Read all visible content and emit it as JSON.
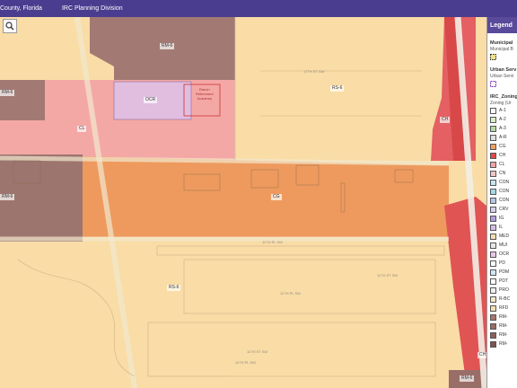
{
  "header": {
    "county": "County, Florida",
    "division": "IRC Planning Division"
  },
  "map": {
    "zones": {
      "rm6_top": "RM-6",
      "rm6_left": "RM-6",
      "rm6_mid": "RM-6",
      "rm6_bottom": "RM-6",
      "ocr": "OCR",
      "cl": "CL",
      "rs6_top": "RS-6",
      "ch": "CH",
      "cg": "CG",
      "rs6_bottom": "RS-6",
      "ch_bottom": "CH"
    },
    "building_label": "Ranch\nRetirement\nAcademy",
    "streets": [
      "17TH ST SW",
      "11TH PL SW",
      "11TH ST SW",
      "11TH PL SW",
      "11TH ST SW",
      "11TH PL SW"
    ]
  },
  "search": {
    "icon": "search-icon"
  },
  "legend": {
    "title": "Legend",
    "layers": [
      {
        "name": "Municipal",
        "sub": "Municipal B"
      },
      {
        "name": "Urban Serv",
        "sub": "Urban Servi"
      },
      {
        "name": "IRC_Zoning",
        "sub": "Zoning (Ur"
      }
    ],
    "items": [
      {
        "code": "A-1",
        "color": "#ffffff"
      },
      {
        "code": "A-2",
        "color": "#dcedc8"
      },
      {
        "code": "A-3",
        "color": "#b6d7a8"
      },
      {
        "code": "A-R",
        "color": "#e0e0e0"
      },
      {
        "code": "CG",
        "color": "#f29d62"
      },
      {
        "code": "CH",
        "color": "#e04a4a"
      },
      {
        "code": "CL",
        "color": "#f7a3a3"
      },
      {
        "code": "CN",
        "color": "#f3c6c6"
      },
      {
        "code": "CON",
        "color": "#c8e6f0"
      },
      {
        "code": "CON",
        "color": "#a8d8e8"
      },
      {
        "code": "CON",
        "color": "#b7c9e2"
      },
      {
        "code": "CRV",
        "color": "#d9d2e9"
      },
      {
        "code": "IG",
        "color": "#b39ddb"
      },
      {
        "code": "IL",
        "color": "#d7bde2"
      },
      {
        "code": "MED",
        "color": "#f5deb3"
      },
      {
        "code": "MUI",
        "color": "#e8e8e8"
      },
      {
        "code": "OCR",
        "color": "#e6c6e6"
      },
      {
        "code": "PD",
        "color": "#ffffff"
      },
      {
        "code": "PDM",
        "color": "#d0e8f5"
      },
      {
        "code": "PDT",
        "color": "#ffffff"
      },
      {
        "code": "PRO",
        "color": "#f0f0f0"
      },
      {
        "code": "R-BC",
        "color": "#f8e7c9"
      },
      {
        "code": "RFD",
        "color": "#f6e0b5"
      },
      {
        "code": "RM-",
        "color": "#a9746e"
      },
      {
        "code": "RM-",
        "color": "#9a6b65"
      },
      {
        "code": "RM-",
        "color": "#8e5f5a"
      },
      {
        "code": "RM-",
        "color": "#7c5450"
      }
    ]
  }
}
